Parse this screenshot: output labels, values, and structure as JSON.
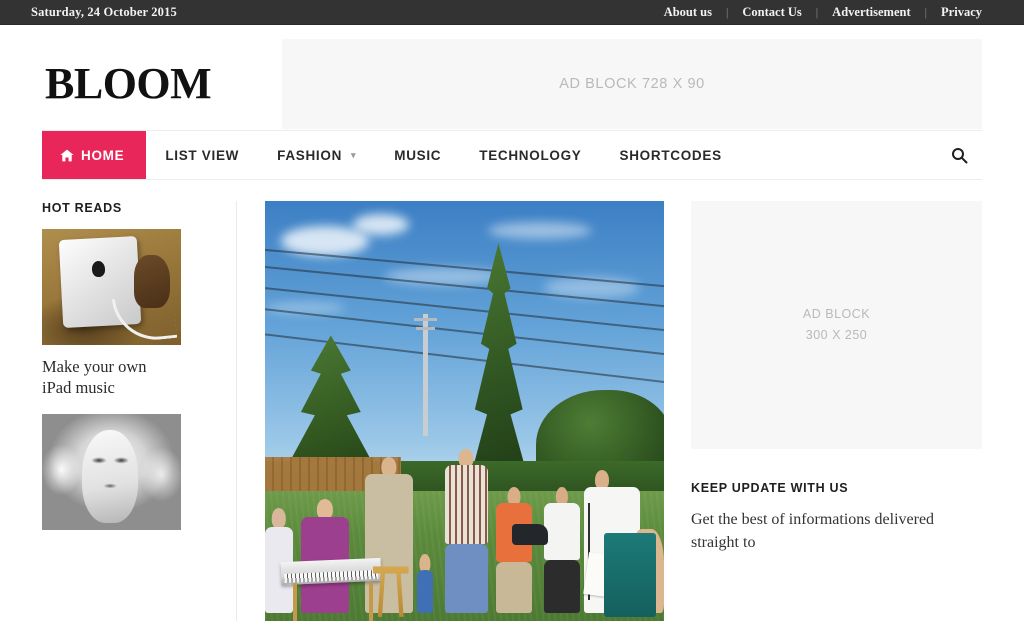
{
  "topbar": {
    "date": "Saturday, 24 October 2015",
    "links": [
      "About us",
      "Contact Us",
      "Advertisement",
      "Privacy"
    ],
    "separator": "|",
    "background_color": "#333333"
  },
  "header": {
    "logo": "BLOOM",
    "ad_leaderboard": "AD BLOCK 728 X 90"
  },
  "nav": {
    "accent_color": "#e8265a",
    "items": [
      {
        "label": "HOME",
        "active": true,
        "icon": "home-icon",
        "has_dropdown": false
      },
      {
        "label": "LIST VIEW",
        "active": false,
        "icon": null,
        "has_dropdown": false
      },
      {
        "label": "FASHION",
        "active": false,
        "icon": null,
        "has_dropdown": true
      },
      {
        "label": "MUSIC",
        "active": false,
        "icon": null,
        "has_dropdown": false
      },
      {
        "label": "TECHNOLOGY",
        "active": false,
        "icon": null,
        "has_dropdown": false
      },
      {
        "label": "SHORTCODES",
        "active": false,
        "icon": null,
        "has_dropdown": false
      }
    ],
    "search_icon": "search-icon"
  },
  "sidebar_left": {
    "widget_title": "HOT READS",
    "items": [
      {
        "title": "Make your own iPad music",
        "image": "ipad-held-in-hand-photo"
      },
      {
        "title": "",
        "image": "black-and-white-woman-portrait-photo"
      }
    ]
  },
  "main": {
    "hero_image": "outdoor-backyard-band-party-photo"
  },
  "sidebar_right": {
    "ad_line1": "AD BLOCK",
    "ad_line2": "300 X 250",
    "newsletter_title": "KEEP UPDATE WITH US",
    "newsletter_text": "Get the best of informations delivered straight to"
  }
}
